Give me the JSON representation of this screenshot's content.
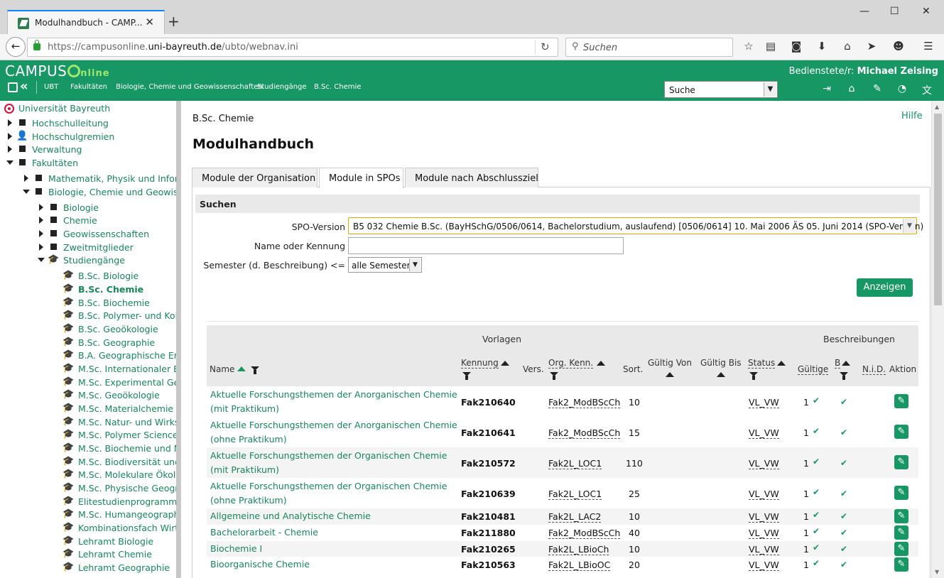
{
  "browser": {
    "tab_title": "Modulhandbuch - CAMP...",
    "url_prefix": "https://campusonline.",
    "url_domain": "uni-bayreuth.de",
    "url_path": "/ubto/webnav.ini",
    "search_placeholder": "Suchen"
  },
  "header": {
    "logo_campus": "CAMPUS",
    "logo_online": "nline",
    "user_label": "Bedienstete/r:",
    "user_name": "Michael Zeising",
    "breadcrumbs": [
      "UBT",
      "Fakultäten",
      "Biologie, Chemie und Geowissenschaften",
      "Studiengänge",
      "B.Sc. Chemie"
    ],
    "search_select": "Suche"
  },
  "sidebar": {
    "root": "Universität Bayreuth",
    "items": [
      {
        "label": "Hochschulleitung"
      },
      {
        "label": "Hochschulgremien"
      },
      {
        "label": "Verwaltung"
      },
      {
        "label": "Fakultäten"
      },
      {
        "label": "Mathematik, Physik und Informa"
      },
      {
        "label": "Biologie, Chemie und Geowisse"
      },
      {
        "label": "Biologie"
      },
      {
        "label": "Chemie"
      },
      {
        "label": "Geowissenschaften"
      },
      {
        "label": "Zweitmitglieder"
      },
      {
        "label": "Studiengänge"
      },
      {
        "label": "B.Sc. Biologie"
      },
      {
        "label": "B.Sc. Chemie"
      },
      {
        "label": "B.Sc. Biochemie"
      },
      {
        "label": "B.Sc. Polymer- und Kollo"
      },
      {
        "label": "B.Sc. Geoökologie"
      },
      {
        "label": "B.Sc. Geographie"
      },
      {
        "label": "B.A. Geographische Entw"
      },
      {
        "label": "M.Sc. Internationaler Elit"
      },
      {
        "label": "M.Sc. Experimental Geo"
      },
      {
        "label": "M.Sc. Geoökologie"
      },
      {
        "label": "M.Sc. Materialchemie un"
      },
      {
        "label": "M.Sc. Natur- und Wirkst"
      },
      {
        "label": "M.Sc. Polymer Science"
      },
      {
        "label": "M.Sc. Biochemie und Mo"
      },
      {
        "label": "M.Sc. Biodiversität und"
      },
      {
        "label": "M.Sc. Molekulare Ökolo"
      },
      {
        "label": "M.Sc. Physische Geogra"
      },
      {
        "label": "Elitestudienprogramm M"
      },
      {
        "label": "M.Sc. Humangeographi"
      },
      {
        "label": "Kombinationsfach Wirts"
      },
      {
        "label": "Lehramt Biologie"
      },
      {
        "label": "Lehramt Chemie"
      },
      {
        "label": "Lehramt Geographie"
      }
    ]
  },
  "main": {
    "subtitle": "B.Sc. Chemie",
    "help": "Hilfe",
    "title": "Modulhandbuch",
    "tabs": [
      {
        "label": "Module der Organisation"
      },
      {
        "label": "Module in SPOs"
      },
      {
        "label": "Module nach Abschlussziel"
      }
    ],
    "search": {
      "heading": "Suchen",
      "spo_label": "SPO-Version",
      "spo_value": "B5 032 Chemie B.Sc. (BayHSchG/0506/0614, Bachelorstudium, auslaufend) [0506/0614] 10. Mai 2006 ÄS 05. Juni 2014 (SPO-Version)",
      "name_label": "Name oder Kennung",
      "name_value": "",
      "semester_label": "Semester (d. Beschreibung) <=",
      "semester_value": "alle Semester",
      "button": "Anzeigen"
    },
    "table": {
      "group_vorlagen": "Vorlagen",
      "group_beschreibungen": "Beschreibungen",
      "headers": {
        "name": "Name",
        "kennung": "Kennung",
        "vers": "Vers.",
        "org": "Org. Kenn.",
        "sort": "Sort.",
        "von": "Gültig Von",
        "bis": "Gültig Bis",
        "status": "Status",
        "gueltige": "Gültige",
        "b": "B",
        "nid": "N.i.D.",
        "aktion": "Aktion"
      },
      "rows": [
        {
          "name1": "Aktuelle Forschungsthemen der Anorganischen Chemie",
          "name2": "(mit Praktikum)",
          "kennung": "Fak210640",
          "org": "Fak2_ModBScCh",
          "sort": "10",
          "status": "VL_VW",
          "gueltige": "1"
        },
        {
          "name1": "Aktuelle Forschungsthemen der Anorganischen Chemie",
          "name2": "(ohne Praktikum)",
          "kennung": "Fak210641",
          "org": "Fak2_ModBScCh",
          "sort": "15",
          "status": "VL_VW",
          "gueltige": "1"
        },
        {
          "name1": "Aktuelle Forschungsthemen der Organischen Chemie",
          "name2": "(mit Praktikum)",
          "kennung": "Fak210572",
          "org": "Fak2L_LOC1",
          "sort": "110",
          "status": "VL_VW",
          "gueltige": "1"
        },
        {
          "name1": "Aktuelle Forschungsthemen der Organischen Chemie",
          "name2": "(ohne Praktikum)",
          "kennung": "Fak210639",
          "org": "Fak2L_LOC1",
          "sort": "25",
          "status": "VL_VW",
          "gueltige": "1"
        },
        {
          "name1": "Allgemeine und Analytische Chemie",
          "name2": "",
          "kennung": "Fak210481",
          "org": "Fak2L_LAC2",
          "sort": "10",
          "status": "VL_VW",
          "gueltige": "1"
        },
        {
          "name1": "Bachelorarbeit - Chemie",
          "name2": "",
          "kennung": "Fak211880",
          "org": "Fak2_ModBScCh",
          "sort": "40",
          "status": "VL_VW",
          "gueltige": "1"
        },
        {
          "name1": "Biochemie I",
          "name2": "",
          "kennung": "Fak210265",
          "org": "Fak2L_LBioCh",
          "sort": "10",
          "status": "VL_VW",
          "gueltige": "1"
        },
        {
          "name1": "Bioorganische Chemie",
          "name2": "",
          "kennung": "Fak210563",
          "org": "Fak2L_LBioOC",
          "sort": "20",
          "status": "VL_VW",
          "gueltige": "1"
        }
      ]
    }
  }
}
